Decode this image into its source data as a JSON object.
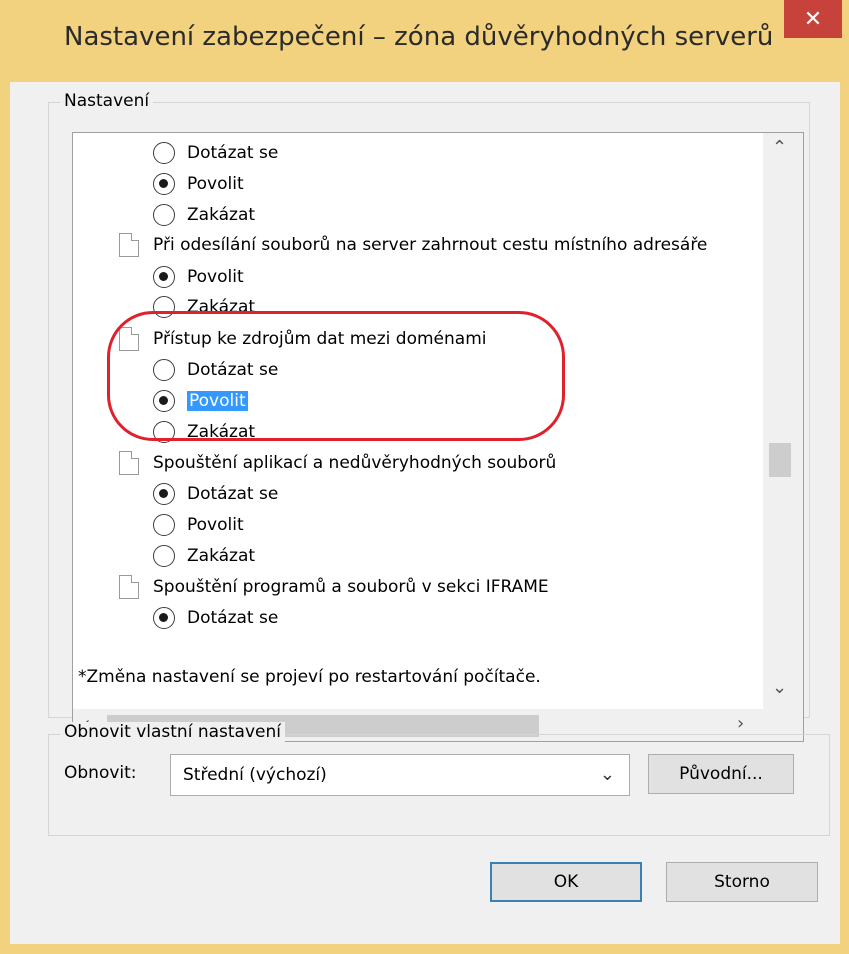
{
  "window": {
    "title": "Nastavení zabezpečení – zóna důvěryhodných serverů",
    "close_symbol": "✕"
  },
  "settings_group": {
    "legend": "Nastavení",
    "rows": [
      {
        "type": "radio",
        "label": "Dotázat se",
        "checked": false
      },
      {
        "type": "radio",
        "label": "Povolit",
        "checked": true
      },
      {
        "type": "radio",
        "label": "Zakázat",
        "checked": false
      },
      {
        "type": "header",
        "label": "Při odesílání souborů na server zahrnout cestu místního adresáře"
      },
      {
        "type": "radio",
        "label": "Povolit",
        "checked": true
      },
      {
        "type": "radio",
        "label": "Zakázat",
        "checked": false
      },
      {
        "type": "header",
        "label": "Přístup ke zdrojům dat mezi doménami"
      },
      {
        "type": "radio",
        "label": "Dotázat se",
        "checked": false
      },
      {
        "type": "radio",
        "label": "Povolit",
        "checked": true,
        "selected": true
      },
      {
        "type": "radio",
        "label": "Zakázat",
        "checked": false
      },
      {
        "type": "header",
        "label": "Spouštění aplikací a nedůvěryhodných souborů"
      },
      {
        "type": "radio",
        "label": "Dotázat se",
        "checked": true
      },
      {
        "type": "radio",
        "label": "Povolit",
        "checked": false
      },
      {
        "type": "radio",
        "label": "Zakázat",
        "checked": false
      },
      {
        "type": "header",
        "label": "Spouštění programů a souborů v sekci IFRAME"
      },
      {
        "type": "radio",
        "label": "Dotázat se",
        "checked": true
      }
    ],
    "note": "*Změna nastavení se projeví po restartování počítače."
  },
  "reset_group": {
    "legend": "Obnovit vlastní nastavení",
    "reset_label": "Obnovit:",
    "select_value": "Střední (výchozí)",
    "reset_button": "Původní..."
  },
  "buttons": {
    "ok": "OK",
    "cancel": "Storno"
  },
  "colors": {
    "title_bar": "#f2d27e",
    "close_button": "#c7423a",
    "selection": "#3399ff",
    "annotation": "#e0202a"
  }
}
